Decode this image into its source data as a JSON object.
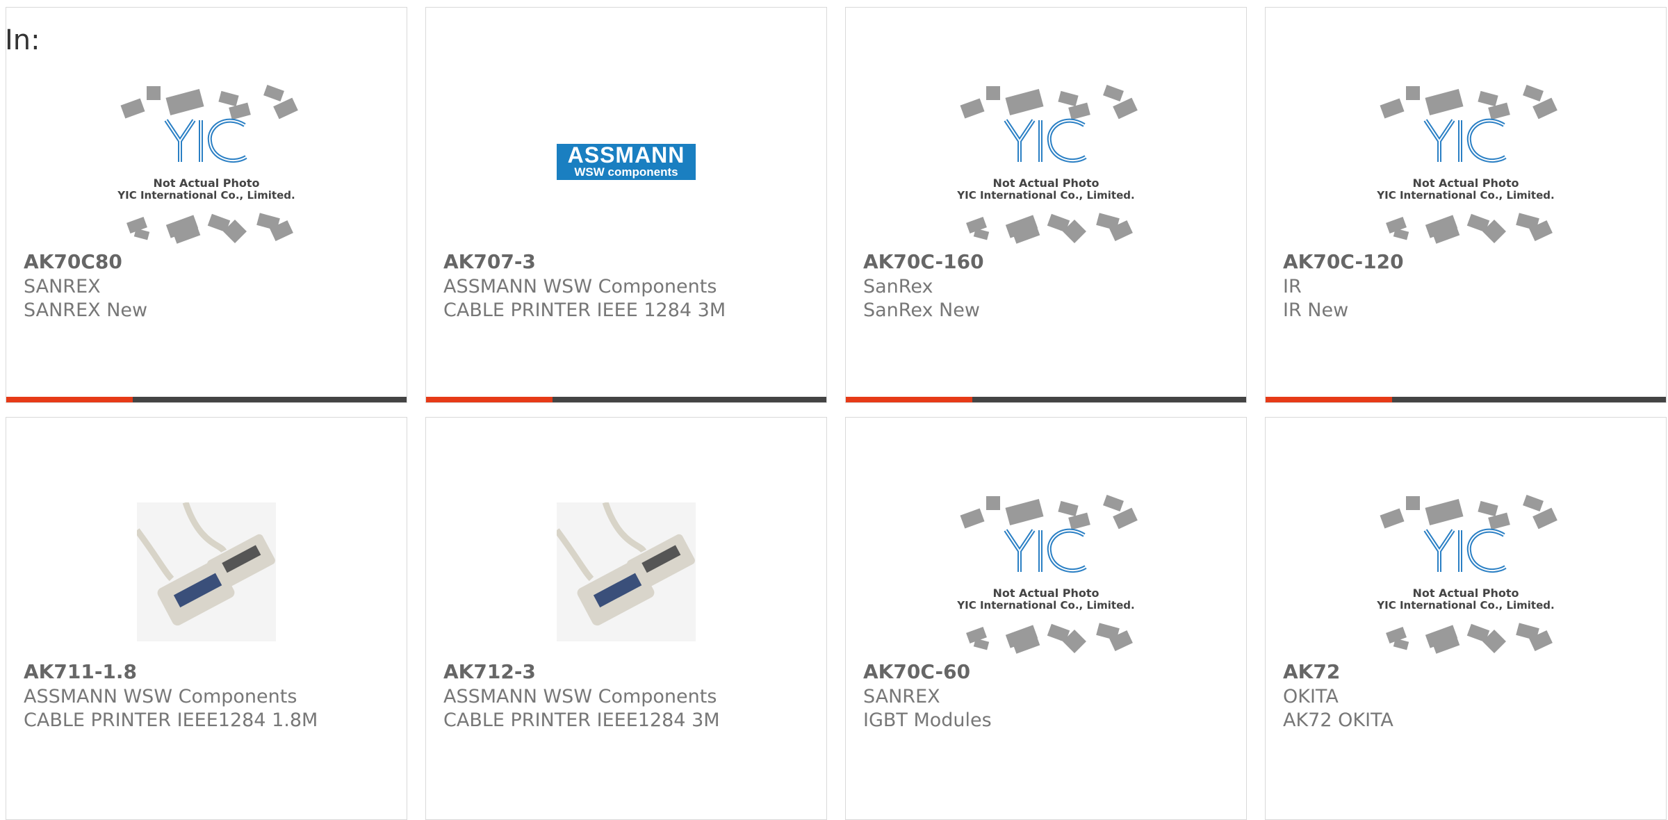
{
  "header": {
    "in_label": "In:"
  },
  "placeholder": {
    "line1": "Not Actual Photo",
    "line2": "YIC International Co., Limited."
  },
  "brand_logo": {
    "word": "ASSMANN",
    "sub": "WSW components"
  },
  "colors": {
    "accent": "#e63a17",
    "bar": "#444444",
    "border": "#d9d9d9"
  },
  "products": [
    {
      "pn": "AK70C80",
      "mfr": "SANREX",
      "desc": "SANREX New",
      "image": "yic-placeholder"
    },
    {
      "pn": "AK707-3",
      "mfr": "ASSMANN WSW Components",
      "desc": "CABLE PRINTER IEEE 1284 3M",
      "image": "assmann-logo"
    },
    {
      "pn": "AK70C-160",
      "mfr": "SanRex",
      "desc": "SanRex New",
      "image": "yic-placeholder"
    },
    {
      "pn": "AK70C-120",
      "mfr": "IR",
      "desc": "IR New",
      "image": "yic-placeholder"
    },
    {
      "pn": "AK711-1.8",
      "mfr": "ASSMANN WSW Components",
      "desc": "CABLE PRINTER IEEE1284 1.8M",
      "image": "printer-cable"
    },
    {
      "pn": "AK712-3",
      "mfr": "ASSMANN WSW Components",
      "desc": "CABLE PRINTER IEEE1284 3M",
      "image": "printer-cable"
    },
    {
      "pn": "AK70C-60",
      "mfr": "SANREX",
      "desc": "IGBT Modules",
      "image": "yic-placeholder"
    },
    {
      "pn": "AK72",
      "mfr": "OKITA",
      "desc": "AK72 OKITA",
      "image": "yic-placeholder"
    }
  ]
}
